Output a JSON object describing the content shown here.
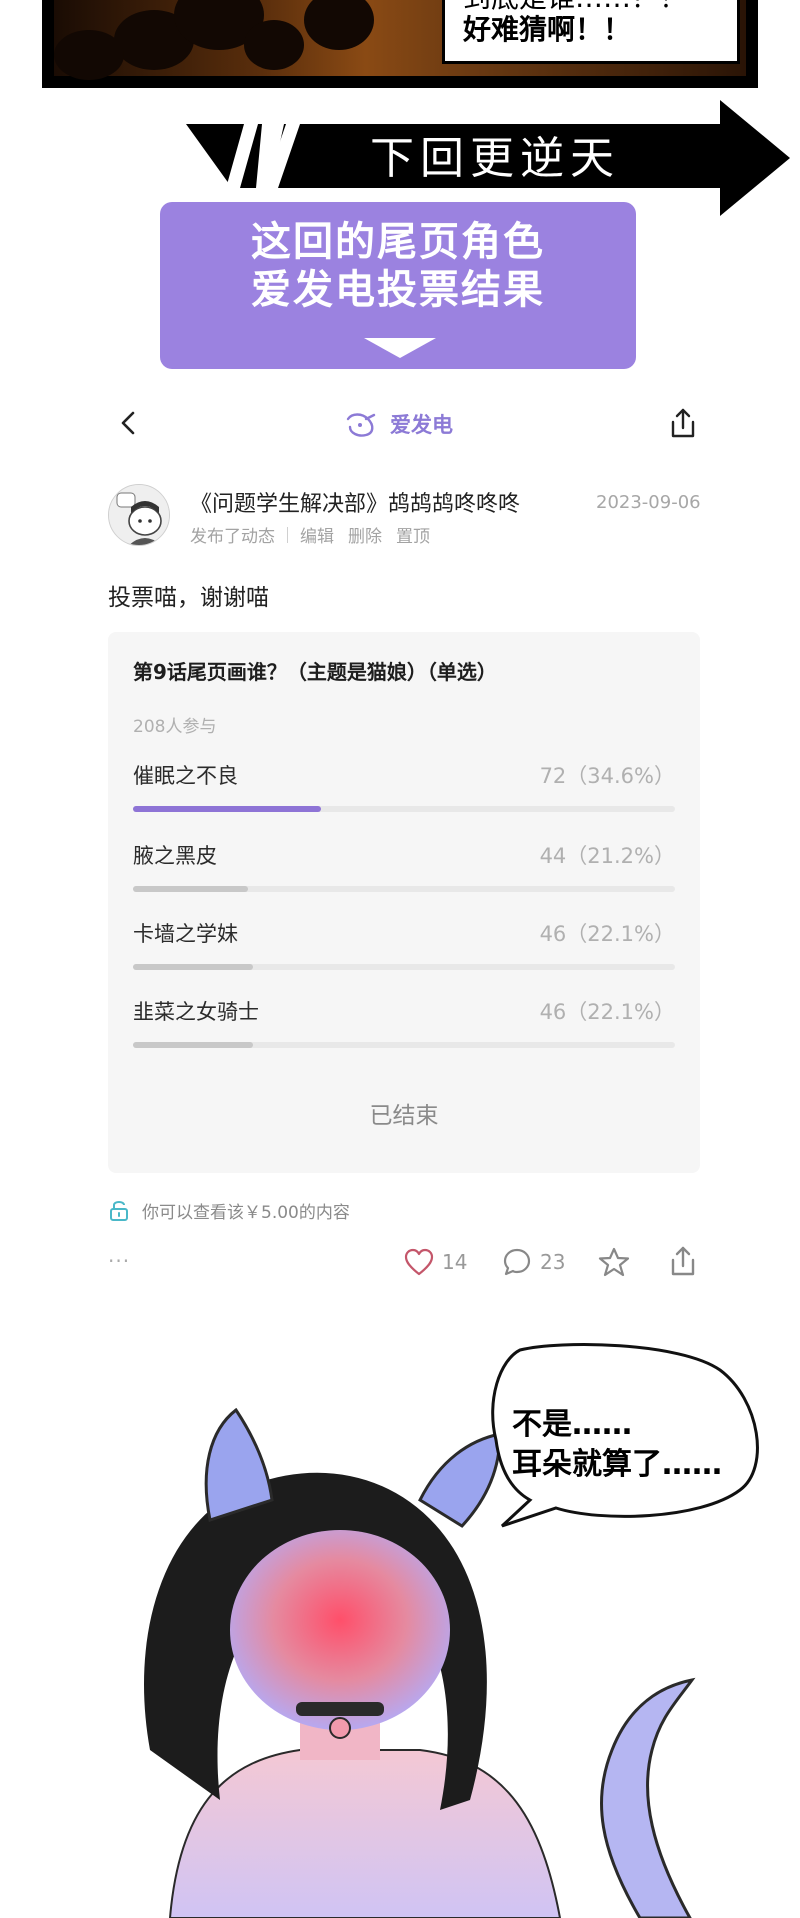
{
  "comic_top": {
    "bubble_line1": "到底是谁……？！",
    "bubble_line2": "好难猜啊！！"
  },
  "next_banner": {
    "text": "下回更逆天"
  },
  "vote_banner": {
    "line1": "这回的尾页角色",
    "line2": "爱发电投票结果"
  },
  "app_header": {
    "brand_name": "爱发电",
    "back_icon": "chevron-left-icon",
    "share_icon": "share-icon",
    "brand_color": "#8c7ad6"
  },
  "post": {
    "title": "《问题学生解决部》鸪鸪鸪咚咚咚",
    "date": "2023-09-06",
    "meta": {
      "published": "发布了动态",
      "actions": [
        "编辑",
        "删除",
        "置顶"
      ]
    },
    "body": "投票喵，谢谢喵"
  },
  "poll": {
    "title": "第9话尾页画谁？（主题是猫娘）（单选）",
    "participants": "208人参与",
    "options": [
      {
        "label": "催眠之不良",
        "result": "72（34.6%）",
        "percent": 34.6
      },
      {
        "label": "腋之黑皮",
        "result": "44（21.2%）",
        "percent": 21.2
      },
      {
        "label": "卡墙之学妹",
        "result": "46（22.1%）",
        "percent": 22.1
      },
      {
        "label": "韭菜之女骑士",
        "result": "46（22.1%）",
        "percent": 22.1
      }
    ],
    "status": "已结束",
    "accent_color": "#8e74d6"
  },
  "unlock": {
    "icon": "unlock-icon",
    "text": "你可以查看该￥5.00的内容"
  },
  "actions": {
    "more": "···",
    "likes": "14",
    "comments": "23",
    "icons": [
      "heart-icon",
      "comment-icon",
      "star-icon",
      "share-icon"
    ],
    "like_color": "#c4566a"
  },
  "comic_bottom": {
    "bubble_line1": "不是……",
    "bubble_line2": "耳朵就算了……"
  }
}
